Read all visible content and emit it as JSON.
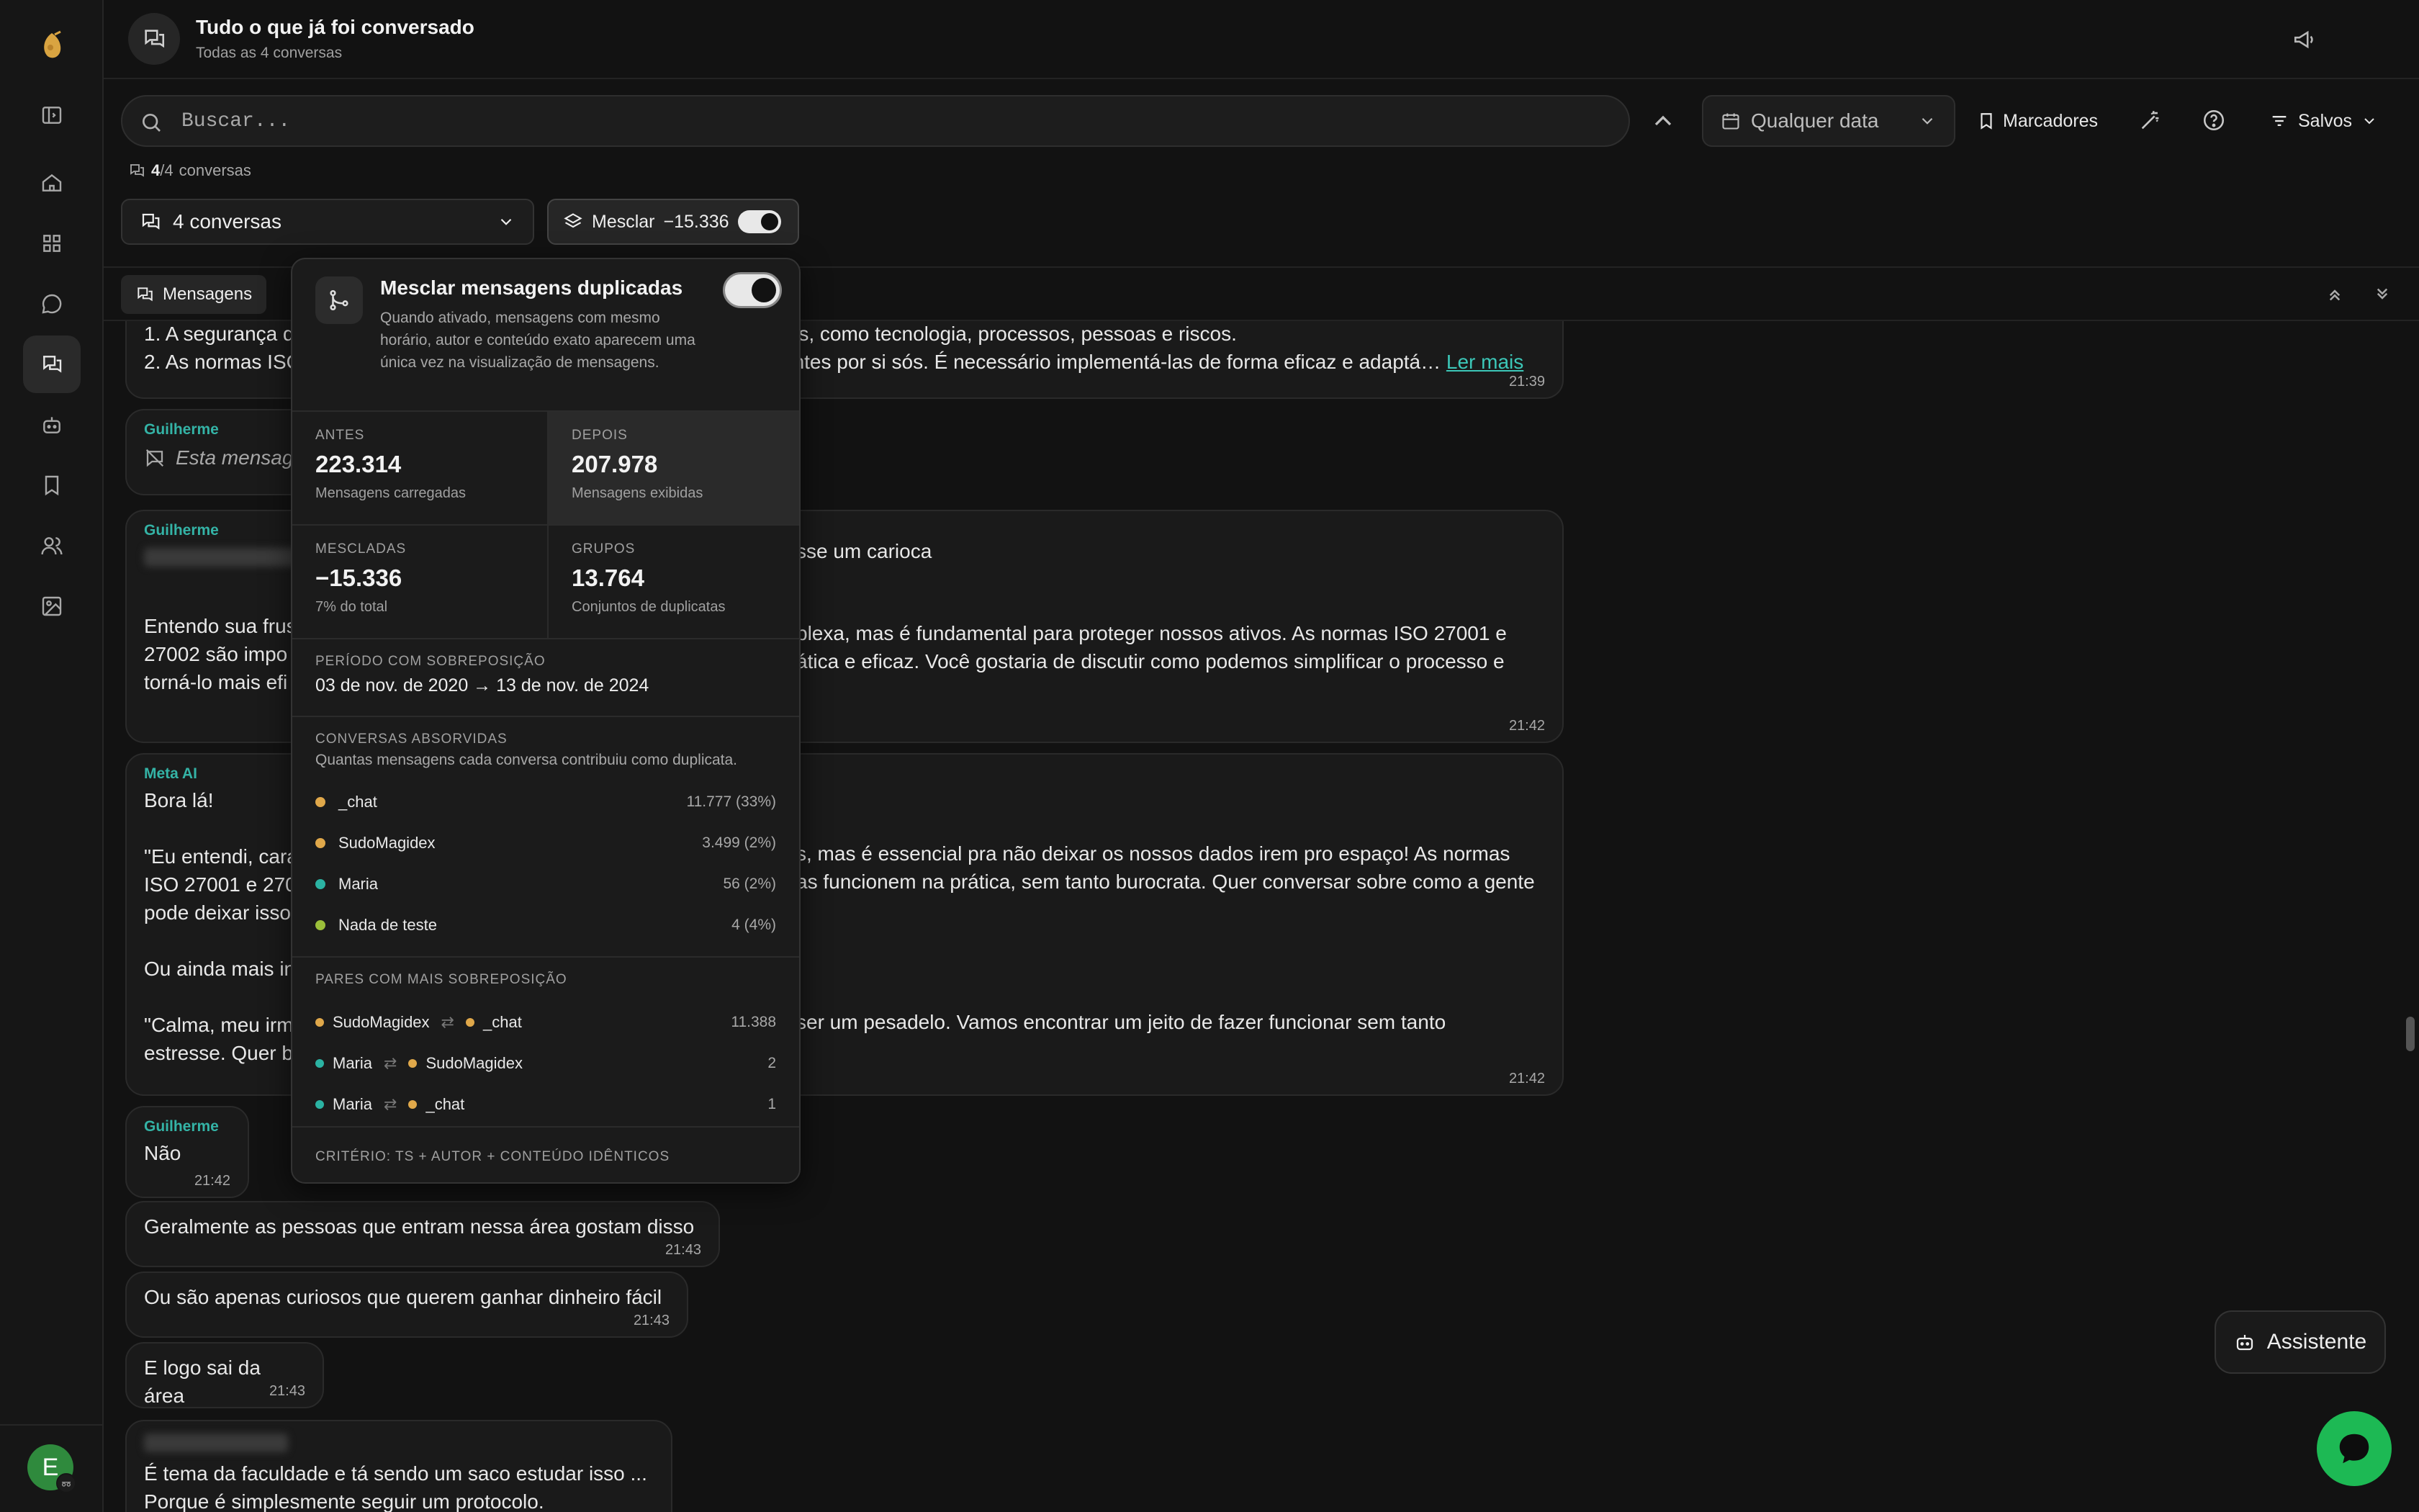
{
  "header": {
    "title": "Tudo o que já foi conversado",
    "subtitle": "Todas as 4 conversas"
  },
  "search": {
    "placeholder": "Buscar...",
    "date_filter": "Qualquer data",
    "bookmarks_label": "Marcadores",
    "saved_label": "Salvos"
  },
  "counts": {
    "shown": "4",
    "sep": "/",
    "total": "4",
    "suffix": "conversas"
  },
  "conversation_select": "4 conversas",
  "merge_button": {
    "label": "Mesclar",
    "delta": "−15.336",
    "enabled": true
  },
  "tabs": {
    "messages": "Mensagens"
  },
  "popover": {
    "title": "Mesclar mensagens duplicadas",
    "description": "Quando ativado, mensagens com mesmo horário, autor e conteúdo exato aparecem uma única vez na visualização de mensagens.",
    "stats": {
      "before": {
        "label": "ANTES",
        "value": "223.314",
        "desc": "Mensagens carregadas"
      },
      "after": {
        "label": "DEPOIS",
        "value": "207.978",
        "desc": "Mensagens exibidas"
      },
      "merged": {
        "label": "MESCLADAS",
        "value": "−15.336",
        "desc": "7% do total"
      },
      "groups": {
        "label": "GRUPOS",
        "value": "13.764",
        "desc": "Conjuntos de duplicatas"
      }
    },
    "overlap_period": {
      "label": "PERÍODO COM SOBREPOSIÇÃO",
      "value": "03 de nov. de 2020 → 13 de nov. de 2024"
    },
    "absorbed": {
      "label": "CONVERSAS ABSORVIDAS",
      "desc": "Quantas mensagens cada conversa contribuiu como duplicata.",
      "items": [
        {
          "name": "_chat",
          "value": "11.777 (33%)",
          "color": "#e0a84a"
        },
        {
          "name": "SudoMagidex",
          "value": "3.499 (2%)",
          "color": "#e0a84a"
        },
        {
          "name": "Maria",
          "value": "56 (2%)",
          "color": "#2bb3a3"
        },
        {
          "name": "Nada de teste",
          "value": "4 (4%)",
          "color": "#9bbf3a"
        }
      ]
    },
    "pairs": {
      "label": "PARES COM MAIS SOBREPOSIÇÃO",
      "arrow": "⇄",
      "items": [
        {
          "a": "SudoMagidex",
          "a_color": "#e0a84a",
          "b": "_chat",
          "b_color": "#e0a84a",
          "value": "11.388"
        },
        {
          "a": "Maria",
          "a_color": "#2bb3a3",
          "b": "SudoMagidex",
          "b_color": "#e0a84a",
          "value": "2"
        },
        {
          "a": "Maria",
          "a_color": "#2bb3a3",
          "b": "_chat",
          "b_color": "#e0a84a",
          "value": "1"
        }
      ]
    },
    "criteria": "CRITÉRIO: TS + AUTOR + CONTEÚDO IDÊNTICOS"
  },
  "messages": [
    {
      "lines": [
        "1. A segurança d",
        "2. As normas ISO"
      ],
      "right_lines": [
        "tos, como tecnologia, processos, pessoas e riscos.",
        "entes por si sós. É necessário implementá-las de forma eficaz e adaptá…"
      ],
      "link": "Ler mais",
      "time": "21:39"
    },
    {
      "author": "Guilherme",
      "text": "Esta mensag",
      "time": ""
    },
    {
      "author": "Guilherme",
      "right_top": "sse um carioca",
      "lines": [
        "Entendo sua frus",
        "27002 são impo",
        "torná-lo mais efi"
      ],
      "right_lines": [
        "plexa, mas é fundamental para proteger nossos ativos. As normas ISO 27001 e",
        "ática e eficaz. Você gostaria de discutir como podemos simplificar o processo e"
      ],
      "time": "21:42"
    },
    {
      "author": "Meta AI",
      "lines": [
        "Bora lá!",
        "",
        "\"Eu entendi, cara",
        "ISO 27001 e 270",
        "pode deixar isso",
        "",
        "Ou ainda mais in",
        "",
        "\"Calma, meu irm",
        "estresse. Quer b"
      ],
      "right_lines": [
        "s, mas é essencial pra não deixar os nossos dados irem pro espaço! As normas",
        "as funcionem na prática, sem tanto burocrata. Quer conversar sobre como a gente",
        "ser um pesadelo. Vamos encontrar um jeito de fazer funcionar sem tanto"
      ],
      "time": "21:42"
    },
    {
      "author": "Guilherme",
      "text": "Não",
      "time": "21:42"
    },
    {
      "text": "Geralmente as pessoas que entram nessa área gostam disso",
      "time": "21:43"
    },
    {
      "text": "Ou são apenas curiosos que querem ganhar dinheiro fácil",
      "time": "21:43"
    },
    {
      "text": "E logo sai da área",
      "time": "21:43"
    },
    {
      "lines": [
        "É tema da faculdade e tá sendo um saco estudar isso ...",
        "Porque é  simplesmente seguir um protocolo."
      ]
    }
  ],
  "assistant_button": "Assistente"
}
